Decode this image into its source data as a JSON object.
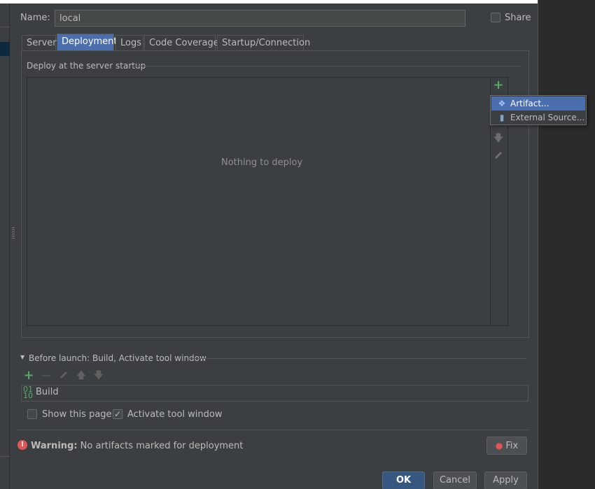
{
  "name_field": {
    "label": "Name:",
    "value": "local"
  },
  "share": {
    "label": "Share",
    "checked": false
  },
  "tabs": [
    {
      "label": "Server",
      "active": false
    },
    {
      "label": "Deployment",
      "active": true
    },
    {
      "label": "Logs",
      "active": false
    },
    {
      "label": "Code Coverage",
      "active": false
    },
    {
      "label": "Startup/Connection",
      "active": false
    }
  ],
  "deployment": {
    "section_title": "Deploy at the server startup",
    "empty_text": "Nothing to deploy",
    "toolbar_icons": [
      "add-icon",
      "move-down-icon",
      "edit-icon"
    ]
  },
  "popup_menu": {
    "items": [
      {
        "label": "Artifact...",
        "icon": "artifact-icon",
        "selected": true
      },
      {
        "label": "External Source...",
        "icon": "external-source-icon",
        "selected": false
      }
    ]
  },
  "before_launch": {
    "title": "Before launch: Build, Activate tool window",
    "toolbar_icons": [
      "add-icon",
      "remove-icon",
      "edit-icon",
      "move-up-icon",
      "move-down-icon"
    ],
    "tasks": [
      {
        "label": "Build",
        "icon": "build-icon"
      }
    ],
    "show_this_page": {
      "label": "Show this page",
      "checked": false
    },
    "activate_tool_window": {
      "label": "Activate tool window",
      "checked": true
    }
  },
  "warning": {
    "prefix": "Warning:",
    "message": "No artifacts marked for deployment",
    "fix_label": "Fix"
  },
  "buttons": {
    "ok": "OK",
    "cancel": "Cancel",
    "apply": "Apply"
  },
  "colors": {
    "background": "#3c3f41",
    "selection": "#4b6eaf",
    "accent_green": "#59a869",
    "warning_red": "#e05555",
    "ok_button": "#365880"
  }
}
